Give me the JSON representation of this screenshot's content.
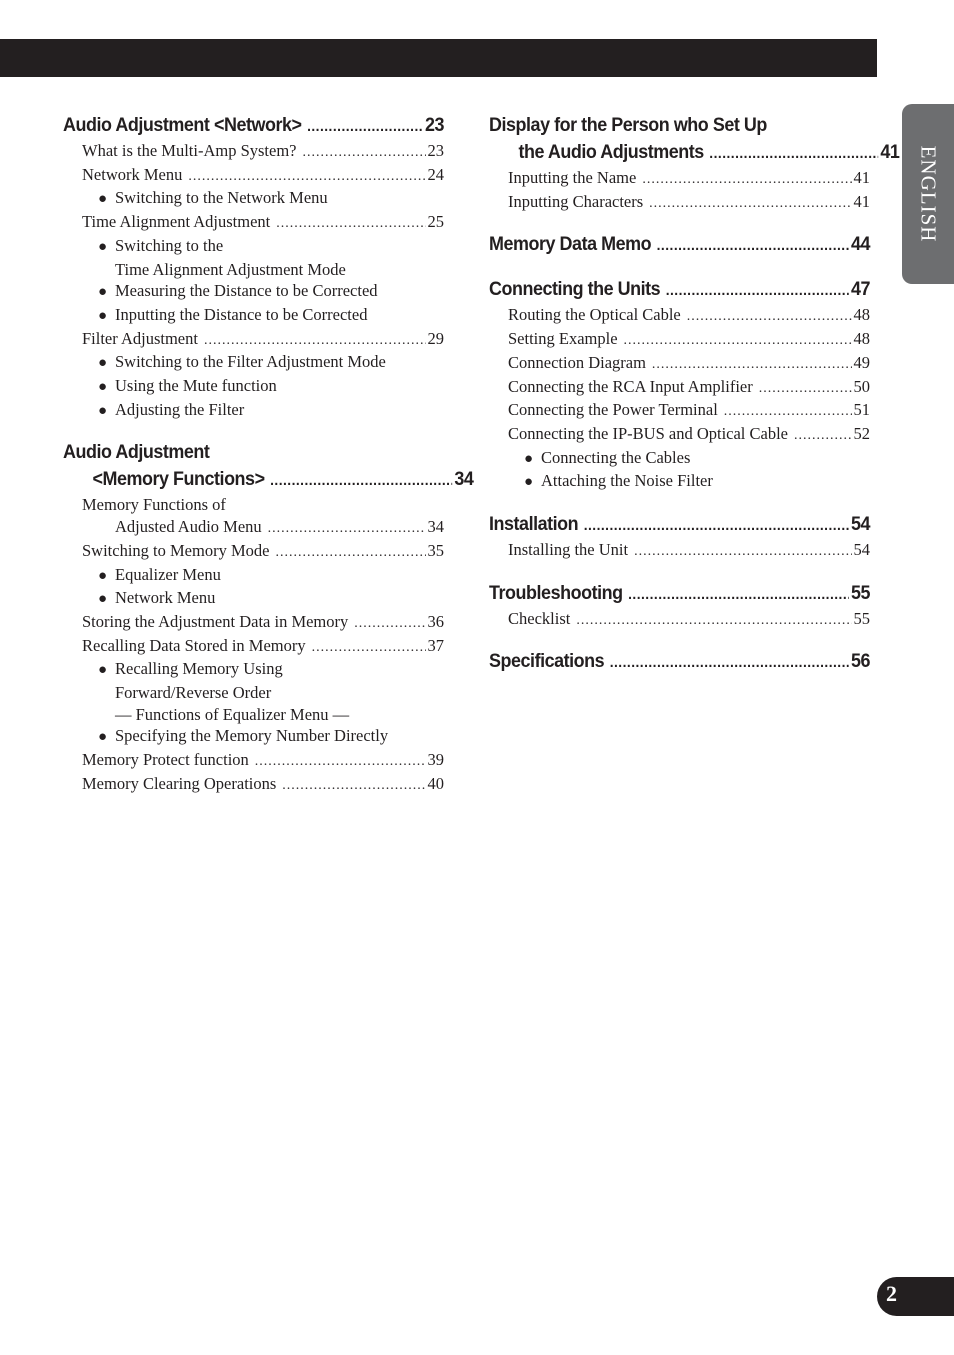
{
  "side_tab": {
    "label": "ENGLISH"
  },
  "page_number": "2",
  "toc": {
    "left": [
      {
        "title": [
          "Audio Adjustment <Network>"
        ],
        "page": "23",
        "items": [
          {
            "type": "entry",
            "text": "What is the Multi-Amp System?",
            "page": "23"
          },
          {
            "type": "entry",
            "text": "Network Menu",
            "page": "24"
          },
          {
            "type": "bullet",
            "lines": [
              "Switching to the Network Menu"
            ]
          },
          {
            "type": "entry",
            "text": "Time Alignment Adjustment",
            "page": "25"
          },
          {
            "type": "bullet",
            "lines": [
              "Switching to the",
              "Time Alignment Adjustment Mode"
            ]
          },
          {
            "type": "bullet",
            "lines": [
              "Measuring the Distance to be Corrected"
            ]
          },
          {
            "type": "bullet",
            "lines": [
              "Inputting the Distance to be Corrected"
            ]
          },
          {
            "type": "entry",
            "text": "Filter Adjustment",
            "page": "29"
          },
          {
            "type": "bullet",
            "lines": [
              "Switching to the Filter Adjustment Mode"
            ]
          },
          {
            "type": "bullet",
            "lines": [
              "Using the Mute function"
            ]
          },
          {
            "type": "bullet",
            "lines": [
              "Adjusting the Filter"
            ]
          }
        ]
      },
      {
        "title": [
          "Audio Adjustment",
          "<Memory Functions>"
        ],
        "page": "34",
        "items": [
          {
            "type": "entry2",
            "text": [
              "Memory Functions of",
              "Adjusted Audio Menu"
            ],
            "page": "34"
          },
          {
            "type": "entry",
            "text": "Switching to Memory Mode",
            "page": "35"
          },
          {
            "type": "bullet",
            "lines": [
              "Equalizer Menu"
            ]
          },
          {
            "type": "bullet",
            "lines": [
              "Network Menu"
            ]
          },
          {
            "type": "entry",
            "text": "Storing the Adjustment Data in Memory",
            "page": "36"
          },
          {
            "type": "entry",
            "text": "Recalling Data Stored in Memory",
            "page": "37"
          },
          {
            "type": "bullet",
            "lines": [
              "Recalling Memory Using",
              "Forward/Reverse Order",
              "— Functions of Equalizer Menu —"
            ]
          },
          {
            "type": "bullet",
            "lines": [
              "Specifying the Memory Number Directly"
            ]
          },
          {
            "type": "entry",
            "text": "Memory Protect function",
            "page": "39"
          },
          {
            "type": "entry",
            "text": "Memory Clearing Operations",
            "page": "40"
          }
        ]
      }
    ],
    "right": [
      {
        "title": [
          "Display for the Person who Set Up",
          "the Audio Adjustments"
        ],
        "page": "41",
        "items": [
          {
            "type": "entry",
            "text": "Inputting the Name",
            "page": "41"
          },
          {
            "type": "entry",
            "text": "Inputting Characters",
            "page": "41"
          }
        ]
      },
      {
        "title": [
          "Memory Data Memo"
        ],
        "page": "44",
        "items": []
      },
      {
        "title": [
          "Connecting the Units"
        ],
        "page": "47",
        "items": [
          {
            "type": "entry",
            "text": "Routing the Optical Cable",
            "page": "48"
          },
          {
            "type": "entry",
            "text": "Setting Example",
            "page": "48"
          },
          {
            "type": "entry",
            "text": "Connection Diagram",
            "page": "49"
          },
          {
            "type": "entry",
            "text": "Connecting the RCA Input Amplifier",
            "page": "50"
          },
          {
            "type": "entry",
            "text": "Connecting the Power Terminal",
            "page": "51"
          },
          {
            "type": "entry",
            "text": "Connecting the IP-BUS and Optical Cable",
            "page": "52"
          },
          {
            "type": "bullet",
            "lines": [
              "Connecting the Cables"
            ]
          },
          {
            "type": "bullet",
            "lines": [
              "Attaching the Noise Filter"
            ]
          }
        ]
      },
      {
        "title": [
          "Installation"
        ],
        "page": "54",
        "items": [
          {
            "type": "entry",
            "text": "Installing the Unit",
            "page": "54"
          }
        ]
      },
      {
        "title": [
          "Troubleshooting"
        ],
        "page": "55",
        "items": [
          {
            "type": "entry",
            "text": "Checklist",
            "page": "55"
          }
        ]
      },
      {
        "title": [
          "Specifications"
        ],
        "page": "56",
        "items": []
      }
    ]
  },
  "colors": {
    "bar": "#231f20",
    "side_tab": "#6d6e70",
    "text": "#231f20"
  }
}
